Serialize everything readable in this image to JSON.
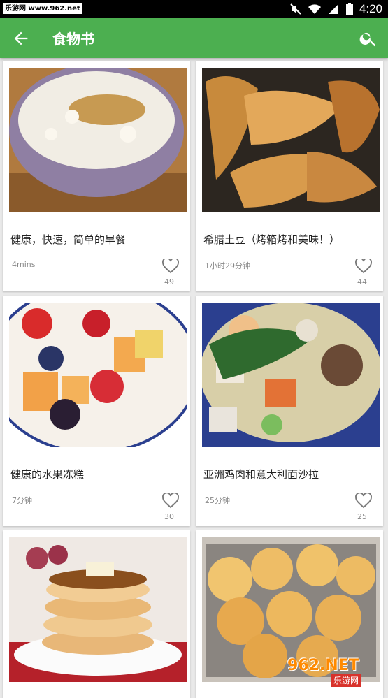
{
  "status_bar": {
    "watermark_site": "乐游网 www.962.net",
    "time": "4:20"
  },
  "toolbar": {
    "title": "食物书",
    "back_icon": "arrow-back-icon",
    "search_icon": "search-icon"
  },
  "colors": {
    "toolbar": "#4caf50",
    "background": "#e9e9e9",
    "card": "#ffffff"
  },
  "recipes": [
    {
      "name": "健康，快速，简单的早餐",
      "time": "4mins",
      "likes": "49"
    },
    {
      "name": "希腊土豆（烤箱烤和美味！）",
      "time": "1小时29分钟",
      "likes": "44"
    },
    {
      "name": "健康的水果冻糕",
      "time": "7分钟",
      "likes": "30"
    },
    {
      "name": "亚洲鸡肉和意大利面沙拉",
      "time": "25分钟",
      "likes": "25"
    }
  ],
  "watermark": {
    "brand": "962.NET",
    "sub": "乐游网"
  }
}
